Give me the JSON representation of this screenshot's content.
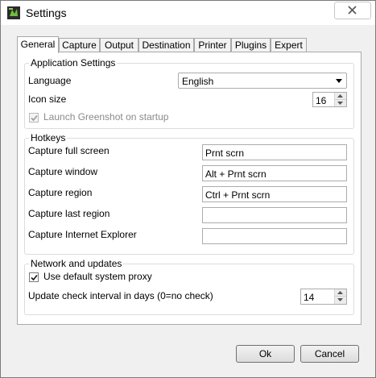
{
  "window": {
    "title": "Settings",
    "close_icon": "close-icon",
    "app_icon": "greenshot-icon"
  },
  "tabs": [
    {
      "label": "General",
      "active": true
    },
    {
      "label": "Capture"
    },
    {
      "label": "Output"
    },
    {
      "label": "Destination"
    },
    {
      "label": "Printer"
    },
    {
      "label": "Plugins"
    },
    {
      "label": "Expert"
    }
  ],
  "application_settings": {
    "legend": "Application Settings",
    "language_label": "Language",
    "language_value": "English",
    "icon_size_label": "Icon size",
    "icon_size_value": "16",
    "launch_on_startup_label": "Launch Greenshot on startup",
    "launch_on_startup_checked": true
  },
  "hotkeys": {
    "legend": "Hotkeys",
    "items": [
      {
        "label": "Capture full screen",
        "value": "Prnt scrn"
      },
      {
        "label": "Capture window",
        "value": "Alt + Prnt scrn"
      },
      {
        "label": "Capture region",
        "value": "Ctrl + Prnt scrn"
      },
      {
        "label": "Capture last region",
        "value": ""
      },
      {
        "label": "Capture Internet Explorer",
        "value": ""
      }
    ]
  },
  "network": {
    "legend": "Network and updates",
    "proxy_label": "Use default system proxy",
    "proxy_checked": true,
    "update_interval_label": "Update check interval in days (0=no check)",
    "update_interval_value": "14"
  },
  "footer": {
    "ok_label": "Ok",
    "cancel_label": "Cancel"
  },
  "colors": {
    "window_bg": "#f0f0f0",
    "panel_bg": "#ffffff",
    "border": "#a9a9a9"
  }
}
